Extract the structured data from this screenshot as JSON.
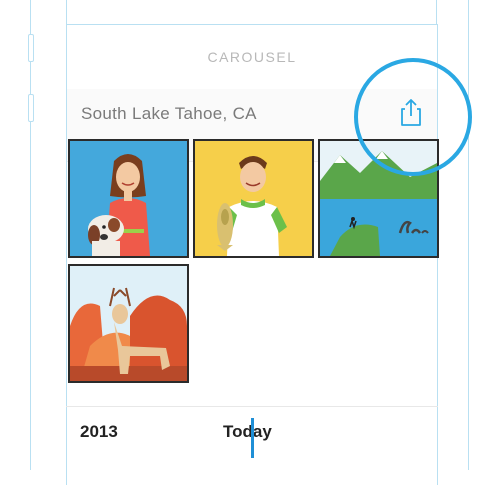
{
  "nav": {
    "title": "CAROUSEL"
  },
  "location": {
    "label": "South Lake Tahoe, CA"
  },
  "share": {
    "icon": "share-icon"
  },
  "photos": [
    {
      "subject": "woman-with-dog"
    },
    {
      "subject": "man-with-fish"
    },
    {
      "subject": "lake-monster-landscape"
    },
    {
      "subject": "deer-red-rocks"
    }
  ],
  "timeline": {
    "start_label": "2013",
    "current_label": "Today"
  },
  "colors": {
    "accent": "#2aa8e3",
    "frame": "#b9e0f2",
    "scrubber": "#1f8fd6"
  }
}
